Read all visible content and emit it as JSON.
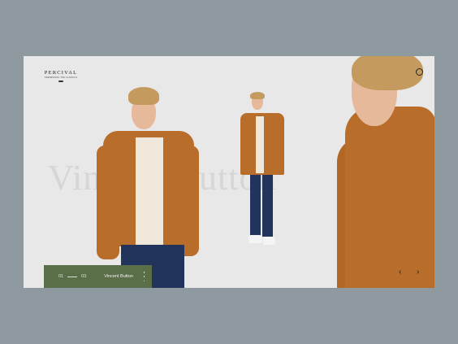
{
  "brand": {
    "name": "PERCIVAL",
    "tagline": "HARNESSING THE CLASSICS"
  },
  "hero": {
    "watermark": "Vincent Button"
  },
  "slide": {
    "current": "01",
    "total": "03",
    "title": "Vincent Button"
  },
  "icons": {
    "search": "search-icon",
    "prev": "chevron-left-icon",
    "next": "chevron-right-icon",
    "more": "kebab-menu-icon"
  },
  "colors": {
    "background": "#8f9aa0",
    "panel": "#e8e8e8",
    "badge": "#5a6e48",
    "jacket": "#b96d2a",
    "jeans": "#22345c"
  }
}
